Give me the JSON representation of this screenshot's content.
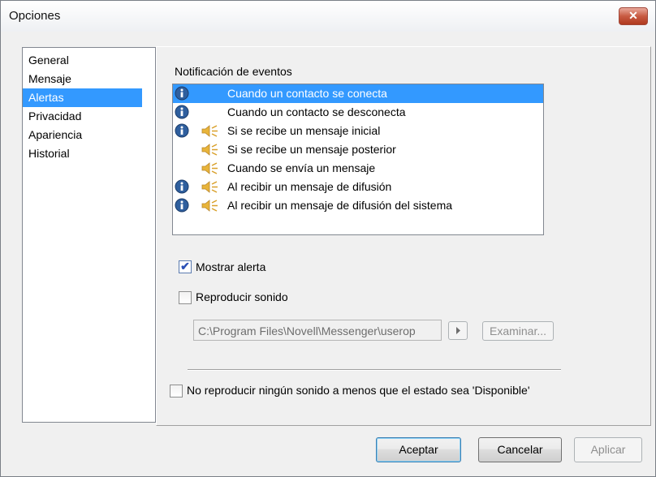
{
  "window": {
    "title": "Opciones",
    "close_label": "✕"
  },
  "categories": [
    {
      "label": "General",
      "selected": false
    },
    {
      "label": "Mensaje",
      "selected": false
    },
    {
      "label": "Alertas",
      "selected": true
    },
    {
      "label": "Privacidad",
      "selected": false
    },
    {
      "label": "Apariencia",
      "selected": false
    },
    {
      "label": "Historial",
      "selected": false
    }
  ],
  "events": {
    "section_label": "Notificación de eventos",
    "items": [
      {
        "label": "Cuando un contacto se conecta",
        "info_icon": true,
        "sound_icon": false,
        "selected": true
      },
      {
        "label": "Cuando un contacto se desconecta",
        "info_icon": true,
        "sound_icon": false,
        "selected": false
      },
      {
        "label": "Si se recibe un mensaje inicial",
        "info_icon": true,
        "sound_icon": true,
        "selected": false
      },
      {
        "label": "Si se recibe un mensaje posterior",
        "info_icon": false,
        "sound_icon": true,
        "selected": false
      },
      {
        "label": "Cuando se envía un mensaje",
        "info_icon": false,
        "sound_icon": true,
        "selected": false
      },
      {
        "label": "Al recibir un mensaje de difusión",
        "info_icon": true,
        "sound_icon": true,
        "selected": false
      },
      {
        "label": "Al recibir un mensaje de difusión del sistema",
        "info_icon": true,
        "sound_icon": true,
        "selected": false
      }
    ]
  },
  "options": {
    "show_alert_label": "Mostrar alerta",
    "show_alert_checked": true,
    "play_sound_label": "Reproducir sonido",
    "play_sound_checked": false,
    "sound_path": "C:\\Program Files\\Novell\\Messenger\\userop",
    "browse_label": "Examinar...",
    "no_sound_label": "No reproducir ningún sonido a menos que el estado sea 'Disponible'",
    "no_sound_checked": false
  },
  "buttons": {
    "ok": "Aceptar",
    "cancel": "Cancelar",
    "apply": "Aplicar"
  },
  "colors": {
    "selection": "#3399ff",
    "info_icon": "#2f5f9e",
    "speaker_icon": "#e8b43a"
  }
}
